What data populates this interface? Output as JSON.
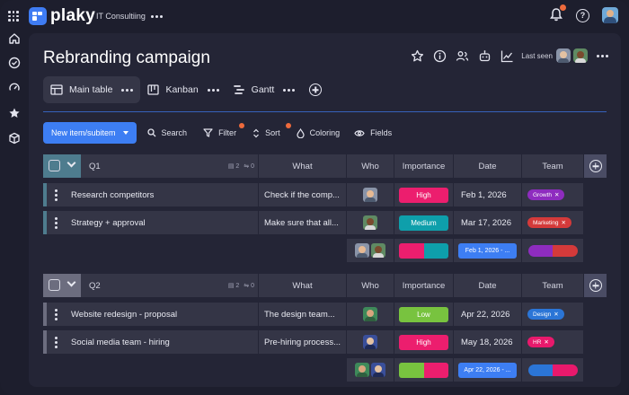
{
  "app": {
    "brand": "plaky",
    "workspace": "IT Consultiing",
    "accent": "#3f7cf3",
    "notification_color": "#ee6a3c",
    "icons": [
      "apps-grid-icon",
      "bell-icon",
      "help-icon"
    ]
  },
  "sidebar": {
    "items": [
      {
        "name": "home",
        "icon": "home-icon"
      },
      {
        "name": "my-work",
        "icon": "check-circle-icon"
      },
      {
        "name": "activity",
        "icon": "dashboard-icon"
      },
      {
        "name": "favorites",
        "icon": "star-icon"
      },
      {
        "name": "boards",
        "icon": "cube-icon"
      }
    ]
  },
  "board": {
    "title": "Rebranding campaign",
    "last_seen_label": "Last seen",
    "views": [
      {
        "label": "Main table",
        "icon": "table-icon",
        "active": true
      },
      {
        "label": "Kanban",
        "icon": "kanban-icon",
        "active": false
      },
      {
        "label": "Gantt",
        "icon": "gantt-icon",
        "active": false
      }
    ]
  },
  "toolbar": {
    "new_item_label": "New item/subitem",
    "search_label": "Search",
    "filter_label": "Filter",
    "sort_label": "Sort",
    "coloring_label": "Coloring",
    "fields_label": "Fields"
  },
  "columns": {
    "what": "What",
    "who": "Who",
    "importance": "Importance",
    "date": "Date",
    "team": "Team"
  },
  "groups": [
    {
      "name": "Q1",
      "color": "#4e7c8e",
      "files_count": "2",
      "subitems_count": "0",
      "items": [
        {
          "name": "Research competitors",
          "what": "Check if the comp...",
          "importance": "High",
          "importance_color": "#ec1e6e",
          "date": "Feb 1, 2026",
          "team": "Growth",
          "team_color": "#8e2cbf"
        },
        {
          "name": "Strategy + approval",
          "what": "Make sure that all...",
          "importance": "Medium",
          "importance_color": "#0e9fab",
          "date": "Mar 17, 2026",
          "team": "Marketing",
          "team_color": "#d43a3a"
        }
      ],
      "summary": {
        "date_range": "Feb 1, 2026 - ...",
        "importance_split": [
          0.5,
          0.5
        ],
        "importance_colors": [
          "#ec1e6e",
          "#0e9fab"
        ],
        "team_split": [
          0.5,
          0.5
        ],
        "team_colors": [
          "#8e2cbf",
          "#d43a3a"
        ]
      }
    },
    {
      "name": "Q2",
      "color": "#6c6d7f",
      "files_count": "2",
      "subitems_count": "0",
      "items": [
        {
          "name": "Website redesign - proposal",
          "what": "The design team...",
          "importance": "Low",
          "importance_color": "#78c33f",
          "date": "Apr 22, 2026",
          "team": "Design",
          "team_color": "#2b75d6"
        },
        {
          "name": "Social media team - hiring",
          "what": "Pre-hiring process...",
          "importance": "High",
          "importance_color": "#ec1e6e",
          "date": "May 18, 2026",
          "team": "HR",
          "team_color": "#e8196c"
        }
      ],
      "summary": {
        "date_range": "Apr 22, 2026 - ...",
        "importance_split": [
          0.5,
          0.5
        ],
        "importance_colors": [
          "#78c33f",
          "#ec1e6e"
        ],
        "team_split": [
          0.5,
          0.5
        ],
        "team_colors": [
          "#2b75d6",
          "#e8196c"
        ]
      }
    }
  ]
}
